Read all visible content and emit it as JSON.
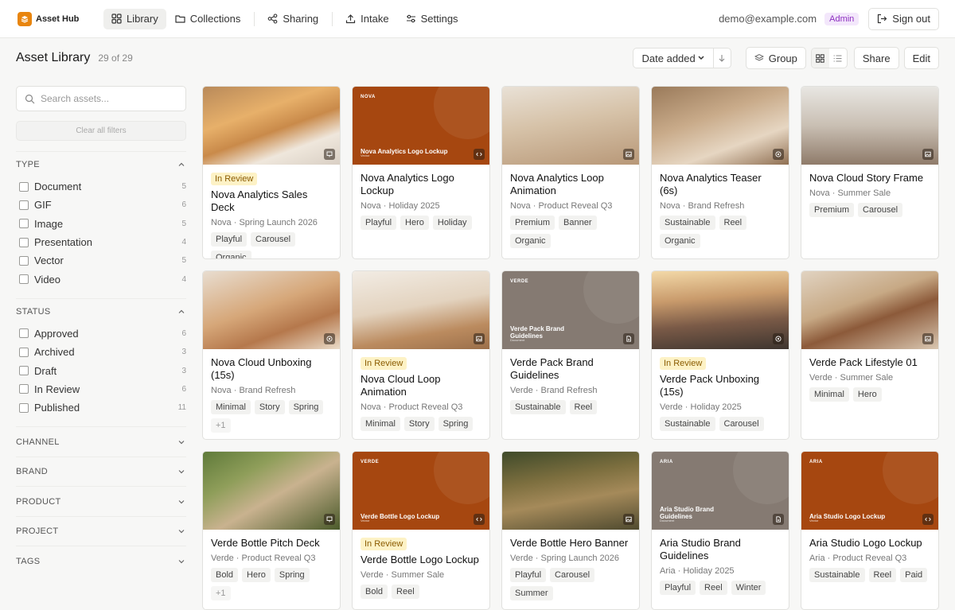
{
  "app": {
    "name": "Asset Hub",
    "brand_color": "#e8850e"
  },
  "nav": [
    {
      "label": "Library",
      "icon": "grid-icon",
      "active": true
    },
    {
      "label": "Collections",
      "icon": "folder-icon"
    },
    {
      "label": "Sharing",
      "icon": "share-icon"
    },
    {
      "label": "Intake",
      "icon": "upload-icon"
    },
    {
      "label": "Settings",
      "icon": "sliders-icon"
    }
  ],
  "user": {
    "email": "demo@example.com",
    "role": "Admin",
    "signout_label": "Sign out"
  },
  "page": {
    "title": "Asset Library",
    "count": "29 of 29"
  },
  "toolbar": {
    "sort_label": "Date added",
    "group_label": "Group",
    "share_label": "Share",
    "edit_label": "Edit"
  },
  "sidebar": {
    "search_placeholder": "Search assets...",
    "clear_label": "Clear all filters",
    "type": {
      "title": "TYPE",
      "options": [
        {
          "label": "Document",
          "count": "5"
        },
        {
          "label": "GIF",
          "count": "6"
        },
        {
          "label": "Image",
          "count": "5"
        },
        {
          "label": "Presentation",
          "count": "4"
        },
        {
          "label": "Vector",
          "count": "5"
        },
        {
          "label": "Video",
          "count": "4"
        }
      ]
    },
    "status": {
      "title": "STATUS",
      "options": [
        {
          "label": "Approved",
          "count": "6"
        },
        {
          "label": "Archived",
          "count": "3"
        },
        {
          "label": "Draft",
          "count": "3"
        },
        {
          "label": "In Review",
          "count": "6"
        },
        {
          "label": "Published",
          "count": "11"
        }
      ]
    },
    "collapsed": [
      "CHANNEL",
      "BRAND",
      "PRODUCT",
      "PROJECT",
      "TAGS"
    ]
  },
  "assets": [
    {
      "title": "Nova Analytics Sales Deck",
      "meta": "Nova · Spring Launch 2026",
      "status": "In Review",
      "tags": [
        "Playful",
        "Carousel",
        "Organic"
      ],
      "thumb": "photo-gold",
      "kind": "presentation-icon"
    },
    {
      "title": "Nova Analytics Logo Lockup",
      "meta": "Nova · Holiday 2025",
      "tags": [
        "Playful",
        "Hero",
        "Holiday"
      ],
      "thumb": "brand-orange",
      "thumb_brand": "NOVA",
      "thumb_title": "Nova Analytics Logo Lockup",
      "thumb_sub": "Vector",
      "kind": "code-icon"
    },
    {
      "title": "Nova Analytics Loop Animation",
      "meta": "Nova · Product Reveal Q3",
      "tags": [
        "Premium",
        "Banner",
        "Organic"
      ],
      "thumb": "photo-desk",
      "kind": "image-icon"
    },
    {
      "title": "Nova Analytics Teaser (6s)",
      "meta": "Nova · Brand Refresh",
      "tags": [
        "Sustainable",
        "Reel",
        "Organic"
      ],
      "thumb": "photo-laptop",
      "kind": "video-icon"
    },
    {
      "title": "Nova Cloud Story Frame",
      "meta": "Nova · Summer Sale",
      "tags": [
        "Premium",
        "Carousel"
      ],
      "thumb": "photo-meeting",
      "kind": "image-icon"
    },
    {
      "title": "Nova Cloud Unboxing (15s)",
      "meta": "Nova · Brand Refresh",
      "tags": [
        "Minimal",
        "Story",
        "Spring",
        "+1"
      ],
      "thumb": "photo-blocks",
      "kind": "video-icon"
    },
    {
      "title": "Nova Cloud Loop Animation",
      "meta": "Nova · Product Reveal Q3",
      "status": "In Review",
      "tags": [
        "Minimal",
        "Story",
        "Spring"
      ],
      "thumb": "photo-workspace",
      "kind": "image-icon"
    },
    {
      "title": "Verde Pack Brand Guidelines",
      "meta": "Verde · Brand Refresh",
      "tags": [
        "Sustainable",
        "Reel"
      ],
      "thumb": "brand-taupe",
      "thumb_brand": "VERDE",
      "thumb_title": "Verde Pack Brand Guidelines",
      "thumb_sub": "Document",
      "kind": "document-icon"
    },
    {
      "title": "Verde Pack Unboxing (15s)",
      "meta": "Verde · Holiday 2025",
      "status": "In Review",
      "tags": [
        "Sustainable",
        "Carousel"
      ],
      "thumb": "photo-hiker",
      "kind": "video-icon"
    },
    {
      "title": "Verde Pack Lifestyle 01",
      "meta": "Verde · Summer Sale",
      "tags": [
        "Minimal",
        "Hero"
      ],
      "thumb": "photo-flatlay",
      "kind": "image-icon"
    },
    {
      "title": "Verde Bottle Pitch Deck",
      "meta": "Verde · Product Reveal Q3",
      "tags": [
        "Bold",
        "Hero",
        "Spring",
        "+1"
      ],
      "thumb": "photo-backpack",
      "kind": "presentation-icon"
    },
    {
      "title": "Verde Bottle Logo Lockup",
      "meta": "Verde · Summer Sale",
      "status": "In Review",
      "tags": [
        "Bold",
        "Reel"
      ],
      "thumb": "brand-orange",
      "thumb_brand": "VERDE",
      "thumb_title": "Verde Bottle Logo Lockup",
      "thumb_sub": "Vector",
      "kind": "code-icon"
    },
    {
      "title": "Verde Bottle Hero Banner",
      "meta": "Verde · Spring Launch 2026",
      "tags": [
        "Playful",
        "Carousel",
        "Summer"
      ],
      "thumb": "photo-forest",
      "kind": "image-icon"
    },
    {
      "title": "Aria Studio Brand Guidelines",
      "meta": "Aria · Holiday 2025",
      "tags": [
        "Playful",
        "Reel",
        "Winter"
      ],
      "thumb": "brand-taupe",
      "thumb_brand": "ARIA",
      "thumb_title": "Aria Studio Brand Guidelines",
      "thumb_sub": "Document",
      "kind": "document-icon"
    },
    {
      "title": "Aria Studio Logo Lockup",
      "meta": "Aria · Product Reveal Q3",
      "tags": [
        "Sustainable",
        "Reel",
        "Paid"
      ],
      "thumb": "brand-orange",
      "thumb_brand": "ARIA",
      "thumb_title": "Aria Studio Logo Lockup",
      "thumb_sub": "Vector",
      "kind": "code-icon"
    }
  ]
}
